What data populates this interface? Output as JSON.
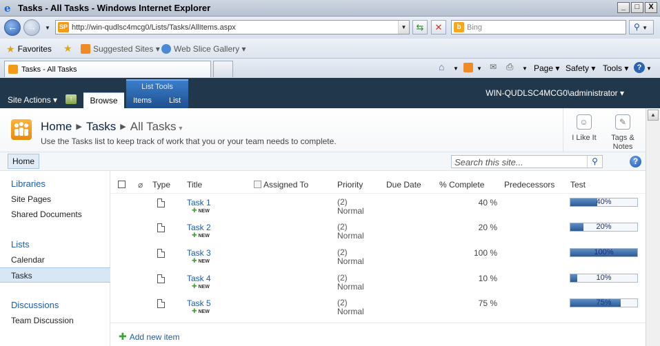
{
  "window": {
    "title": "Tasks - All Tasks - Windows Internet Explorer",
    "min": "_",
    "max": "□",
    "close": "X"
  },
  "address": {
    "url": "http://win-qudlsc4mcg0/Lists/Tasks/AllItems.aspx",
    "search_placeholder": "Bing"
  },
  "favorites": {
    "label": "Favorites",
    "items": [
      "Suggested Sites ▾",
      "Web Slice Gallery ▾"
    ]
  },
  "tab": {
    "label": "Tasks - All Tasks"
  },
  "commands": {
    "page": "Page ▾",
    "safety": "Safety ▾",
    "tools": "Tools ▾"
  },
  "ribbon": {
    "site_actions": "Site Actions ▾",
    "browse": "Browse",
    "list_tools": "List Tools",
    "items": "Items",
    "list": "List",
    "user": "WIN-QUDLSC4MCG0\\administrator ▾"
  },
  "title_area": {
    "breadcrumb": [
      "Home",
      "Tasks",
      "All Tasks"
    ],
    "description": "Use the Tasks list to keep track of work that you or your team needs to complete.",
    "like_label": "I Like It",
    "tags_label_1": "Tags &",
    "tags_label_2": "Notes"
  },
  "topnav": {
    "home": "Home",
    "search_placeholder": "Search this site..."
  },
  "leftnav": {
    "libraries": "Libraries",
    "site_pages": "Site Pages",
    "shared_documents": "Shared Documents",
    "lists": "Lists",
    "calendar": "Calendar",
    "tasks": "Tasks",
    "discussions": "Discussions",
    "team_discussion": "Team Discussion"
  },
  "list": {
    "columns": {
      "type": "Type",
      "title": "Title",
      "assigned_to": "Assigned To",
      "priority": "Priority",
      "due_date": "Due Date",
      "pct_complete": "% Complete",
      "predecessors": "Predecessors",
      "test": "Test"
    },
    "new_badge": "NEW",
    "rows": [
      {
        "title": "Task 1",
        "priority_1": "(2)",
        "priority_2": "Normal",
        "pct": "40 %",
        "test_label": "40%",
        "test_value": 0.4
      },
      {
        "title": "Task 2",
        "priority_1": "(2)",
        "priority_2": "Normal",
        "pct": "20 %",
        "test_label": "20%",
        "test_value": 0.2
      },
      {
        "title": "Task 3",
        "priority_1": "(2)",
        "priority_2": "Normal",
        "pct": "100 %",
        "test_label": "100%",
        "test_value": 1.0
      },
      {
        "title": "Task 4",
        "priority_1": "(2)",
        "priority_2": "Normal",
        "pct": "10 %",
        "test_label": "10%",
        "test_value": 0.1
      },
      {
        "title": "Task 5",
        "priority_1": "(2)",
        "priority_2": "Normal",
        "pct": "75 %",
        "test_label": "75%",
        "test_value": 0.75
      }
    ],
    "add_new": "Add new item"
  }
}
